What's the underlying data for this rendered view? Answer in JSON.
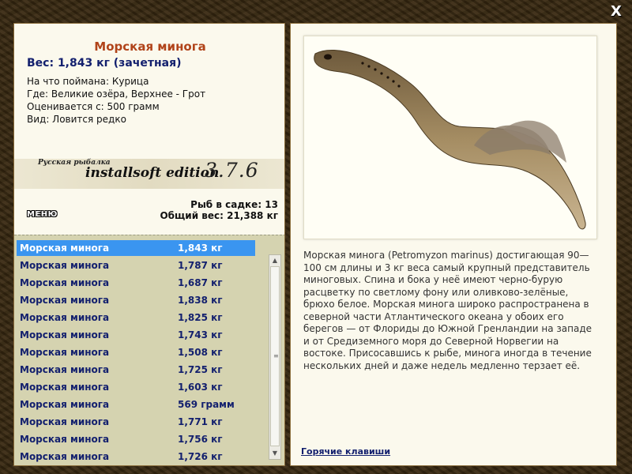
{
  "close_label": "X",
  "fish": {
    "title": "Морская минога",
    "weight_line": "Вес: 1,843 кг (зачетная)",
    "caught_on": "На что поймана: Курица",
    "location": "Где: Великие озёра, Верхнее - Грот",
    "valued_from": "Оценивается с: 500 грамм",
    "rarity": "Вид: Ловится редко"
  },
  "edition": {
    "small": "Русская рыбалка",
    "main": "installsoft edition",
    "version": "3.7.6"
  },
  "menu_label": "МЕНЮ",
  "stats": {
    "fish_count": "Рыб в садке: 13",
    "total_weight": "Общий вес: 21,388 кг"
  },
  "list": [
    {
      "name": "Морская минога",
      "weight": "1,843 кг"
    },
    {
      "name": "Морская минога",
      "weight": "1,787 кг"
    },
    {
      "name": "Морская минога",
      "weight": "1,687 кг"
    },
    {
      "name": "Морская минога",
      "weight": "1,838 кг"
    },
    {
      "name": "Морская минога",
      "weight": "1,825 кг"
    },
    {
      "name": "Морская минога",
      "weight": "1,743 кг"
    },
    {
      "name": "Морская минога",
      "weight": "1,508 кг"
    },
    {
      "name": "Морская минога",
      "weight": "1,725 кг"
    },
    {
      "name": "Морская минога",
      "weight": "1,603 кг"
    },
    {
      "name": "Морская минога",
      "weight": "569 грамм"
    },
    {
      "name": "Морская минога",
      "weight": "1,771 кг"
    },
    {
      "name": "Морская минога",
      "weight": "1,756 кг"
    },
    {
      "name": "Морская минога",
      "weight": "1,726 кг"
    }
  ],
  "description": "Морская минога (Petromyzon marinus) достигающая 90—100 см длины и 3 кг веса самый крупный представитель миноговых. Спина и бока у неё имеют черно-бурую расцветку по светлому фону или оливково-зелёные, брюхо белое. Морская минога широко распространена в северной части Атлантического океана у обоих его берегов — от Флориды до Южной Гренландии на западе и от Средиземного моря до Северной Норвегии на востоке. Присосавшись к рыбе, минога иногда в течение нескольких дней и даже недель медленно терзает её.",
  "hotkeys_label": "Горячие клавиши",
  "colors": {
    "title": "#b1441a",
    "navy": "#13206e",
    "selected": "#3a95f0",
    "list_bg": "#d5d3b0",
    "panel_bg": "#fbf9ed"
  }
}
